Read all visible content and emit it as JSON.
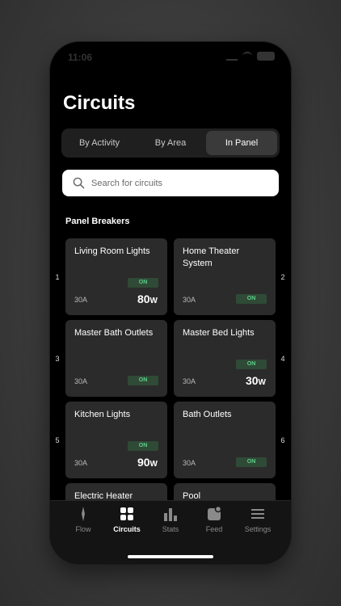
{
  "status": {
    "time": "11:06"
  },
  "page": {
    "title": "Circuits"
  },
  "segments": [
    {
      "label": "By Activity",
      "active": false
    },
    {
      "label": "By Area",
      "active": false
    },
    {
      "label": "In Panel",
      "active": true
    }
  ],
  "search": {
    "placeholder": "Search for circuits"
  },
  "section": {
    "title": "Panel Breakers"
  },
  "breakers": [
    {
      "slot": "1",
      "name": "Living Room Lights",
      "amps": "30A",
      "state": "ON",
      "watts": "80",
      "unit": "W"
    },
    {
      "slot": "2",
      "name": "Home Theater System",
      "amps": "30A",
      "state": "ON",
      "watts": "",
      "unit": ""
    },
    {
      "slot": "3",
      "name": "Master Bath Outlets",
      "amps": "30A",
      "state": "ON",
      "watts": "",
      "unit": ""
    },
    {
      "slot": "4",
      "name": "Master Bed Lights",
      "amps": "30A",
      "state": "ON",
      "watts": "30",
      "unit": "W"
    },
    {
      "slot": "5",
      "name": "Kitchen Lights",
      "amps": "30A",
      "state": "ON",
      "watts": "90",
      "unit": "W"
    },
    {
      "slot": "6",
      "name": "Bath Outlets",
      "amps": "30A",
      "state": "ON",
      "watts": "",
      "unit": ""
    },
    {
      "slot": "",
      "name": "Electric Heater",
      "amps": "",
      "state": "",
      "watts": "",
      "unit": ""
    },
    {
      "slot": "",
      "name": "Pool",
      "amps": "",
      "state": "",
      "watts": "",
      "unit": ""
    }
  ],
  "tabs": [
    {
      "label": "Flow",
      "icon": "flow-icon",
      "active": false
    },
    {
      "label": "Circuits",
      "icon": "circuits-icon",
      "active": true
    },
    {
      "label": "Stats",
      "icon": "stats-icon",
      "active": false
    },
    {
      "label": "Feed",
      "icon": "feed-icon",
      "active": false
    },
    {
      "label": "Settings",
      "icon": "settings-icon",
      "active": false
    }
  ],
  "colors": {
    "accent_green": "#5fd08b",
    "badge_bg": "#2f4a36",
    "card_bg": "#2b2b2b"
  }
}
